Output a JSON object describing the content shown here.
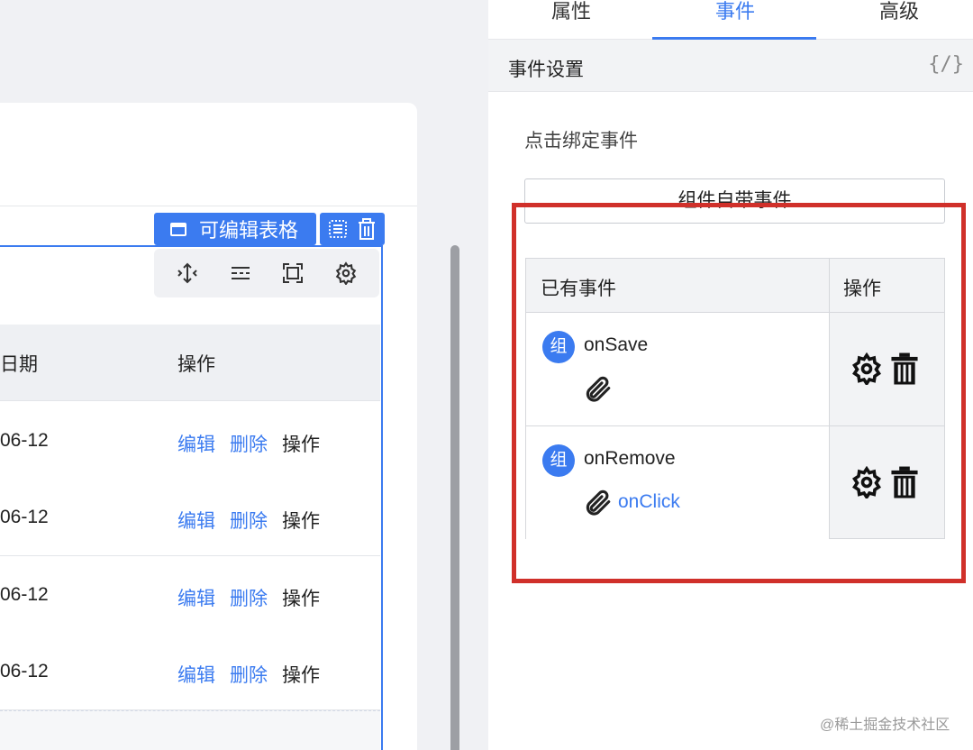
{
  "canvas": {
    "component_badge": "可编辑表格",
    "table": {
      "headers": [
        "日期",
        "操作"
      ],
      "rows": [
        {
          "date": "06-12",
          "edit": "编辑",
          "delete": "删除",
          "op": "操作"
        },
        {
          "date": "06-12",
          "edit": "编辑",
          "delete": "删除",
          "op": "操作"
        },
        {
          "date": "06-12",
          "edit": "编辑",
          "delete": "删除",
          "op": "操作"
        },
        {
          "date": "06-12",
          "edit": "编辑",
          "delete": "删除",
          "op": "操作"
        }
      ]
    }
  },
  "panel": {
    "tabs": [
      "属性",
      "事件",
      "高级"
    ],
    "active_tab": "事件",
    "section_title": "事件设置",
    "code_icon": "{/}",
    "bind_label": "点击绑定事件",
    "builtin_button": "组件自带事件",
    "events_table": {
      "headers": [
        "已有事件",
        "操作"
      ],
      "rows": [
        {
          "badge": "组",
          "name": "onSave",
          "linked": ""
        },
        {
          "badge": "组",
          "name": "onRemove",
          "linked": "onClick"
        }
      ]
    }
  },
  "watermark": "@稀土掘金技术社区",
  "colors": {
    "accent": "#3b7bf0",
    "highlight": "#d0302a"
  }
}
